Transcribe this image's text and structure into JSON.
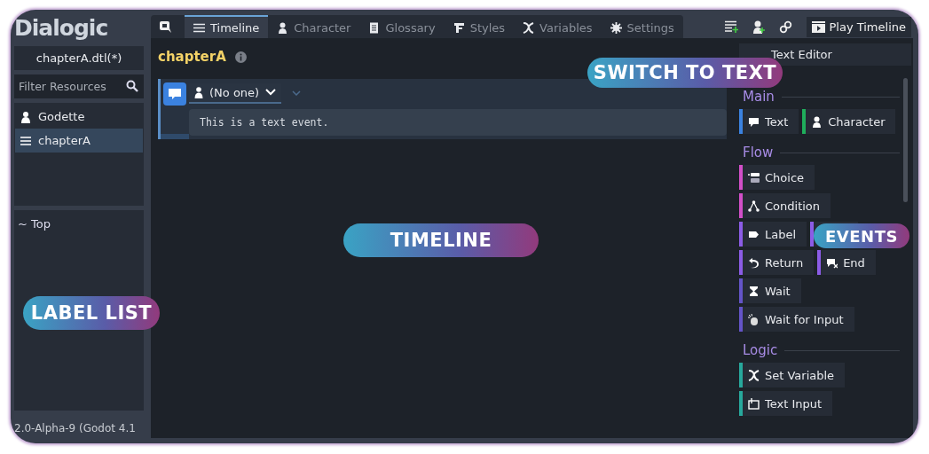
{
  "logo": "Dialogic",
  "sidebar": {
    "file": "chapterA.dtl(*)",
    "filter": {
      "placeholder": "Filter Resources"
    },
    "resources": [
      {
        "label": "Godette",
        "kind": "character",
        "selected": false
      },
      {
        "label": "chapterA",
        "kind": "timeline",
        "selected": true
      }
    ],
    "labels": [
      "~ Top"
    ],
    "version": "2.0-Alpha-9 (Godot 4.1"
  },
  "tabs": [
    {
      "label": "Timeline",
      "selected": true
    },
    {
      "label": "Character",
      "selected": false
    },
    {
      "label": "Glossary",
      "selected": false
    },
    {
      "label": "Styles",
      "selected": false
    },
    {
      "label": "Variables",
      "selected": false
    },
    {
      "label": "Settings",
      "selected": false
    }
  ],
  "play_button": "Play Timeline",
  "timeline": {
    "title": "chapterA",
    "event": {
      "character": "(No one)",
      "text": "This is a text event."
    }
  },
  "text_editor_button": "Text Editor",
  "event_sections": [
    {
      "title": "Main",
      "rows": [
        [
          {
            "label": "Text",
            "color": "#3b82e0"
          },
          {
            "label": "Character",
            "color": "#1fae5b"
          }
        ]
      ]
    },
    {
      "title": "Flow",
      "rows": [
        [
          {
            "label": "Choice",
            "color": "#d24fc8"
          }
        ],
        [
          {
            "label": "Condition",
            "color": "#d24fc8"
          }
        ],
        [
          {
            "label": "Label",
            "color": "#8c5ce6"
          },
          {
            "color": "#8c5ce6"
          }
        ],
        [
          {
            "label": "Return",
            "color": "#8c5ce6"
          },
          {
            "label": "End",
            "color": "#8c5ce6"
          }
        ],
        [
          {
            "label": "Wait",
            "color": "#6454c8"
          }
        ],
        [
          {
            "label": "Wait for Input",
            "color": "#6454c8"
          }
        ]
      ]
    },
    {
      "title": "Logic",
      "rows": [
        [
          {
            "label": "Set Variable",
            "color": "#27a89c"
          }
        ],
        [
          {
            "label": "Text Input",
            "color": "#27a89c"
          }
        ]
      ]
    }
  ],
  "callouts": [
    "SWITCH TO TEXT",
    "TIMELINE",
    "EVENTS",
    "LABEL LIST"
  ]
}
